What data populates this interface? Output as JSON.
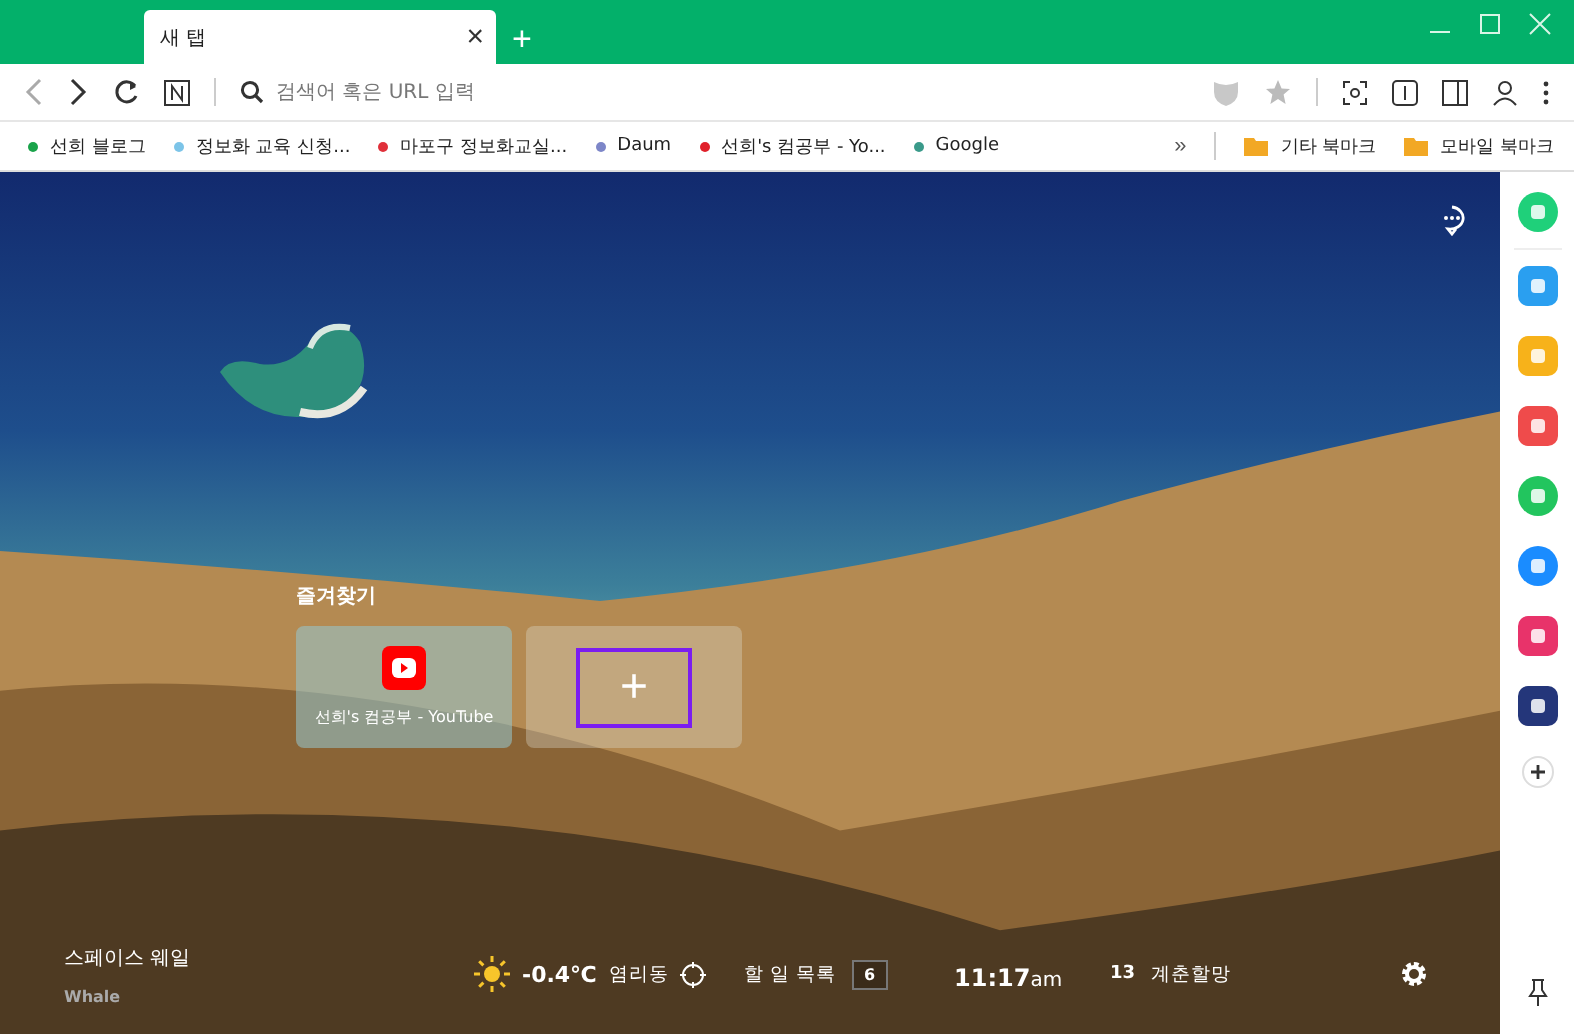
{
  "tab": {
    "title": "새 탭",
    "close": "×",
    "new_tab": "+"
  },
  "address_bar": {
    "placeholder": "검색어 혹은 URL 입력"
  },
  "bookmarks": [
    {
      "label": "선희 블로그",
      "color": "#1aa34a"
    },
    {
      "label": "정보화 교육  신청...",
      "color": "#7cc4e8"
    },
    {
      "label": "마포구 정보화교실...",
      "color": "#e0303a"
    },
    {
      "label": "Daum",
      "color": "#7d86c8"
    },
    {
      "label": "선희's 컴공부 - Yo...",
      "color": "#e0202a"
    },
    {
      "label": "Google",
      "color": "#3a9a8a"
    }
  ],
  "bookmark_overflow": "»",
  "bookmark_folders": [
    "기타 북마크",
    "모바일 북마크"
  ],
  "favorites": {
    "title": "즐겨찾기",
    "items": [
      {
        "label": "선희's 컴공부 - YouTube"
      }
    ],
    "add": "+"
  },
  "space": {
    "title": "스페이스 웨일",
    "subtitle": "Whale"
  },
  "weather": {
    "temperature": "-0.4℃",
    "place": "염리동"
  },
  "todo": {
    "label": "할 일 목록",
    "count": "6"
  },
  "clock": {
    "time": "11:17",
    "suffix": "am"
  },
  "solar_term": {
    "day": "13",
    "name": "계춘할망"
  },
  "sidebar_apps": [
    {
      "color": "#1fd07a"
    },
    {
      "color": "#2a9ff0"
    },
    {
      "color": "#f7b21a"
    },
    {
      "color": "#ef4b4b"
    },
    {
      "color": "#22c55e"
    },
    {
      "color": "#1a8cff"
    },
    {
      "color": "#e8336a"
    },
    {
      "color": "#24367a"
    }
  ]
}
